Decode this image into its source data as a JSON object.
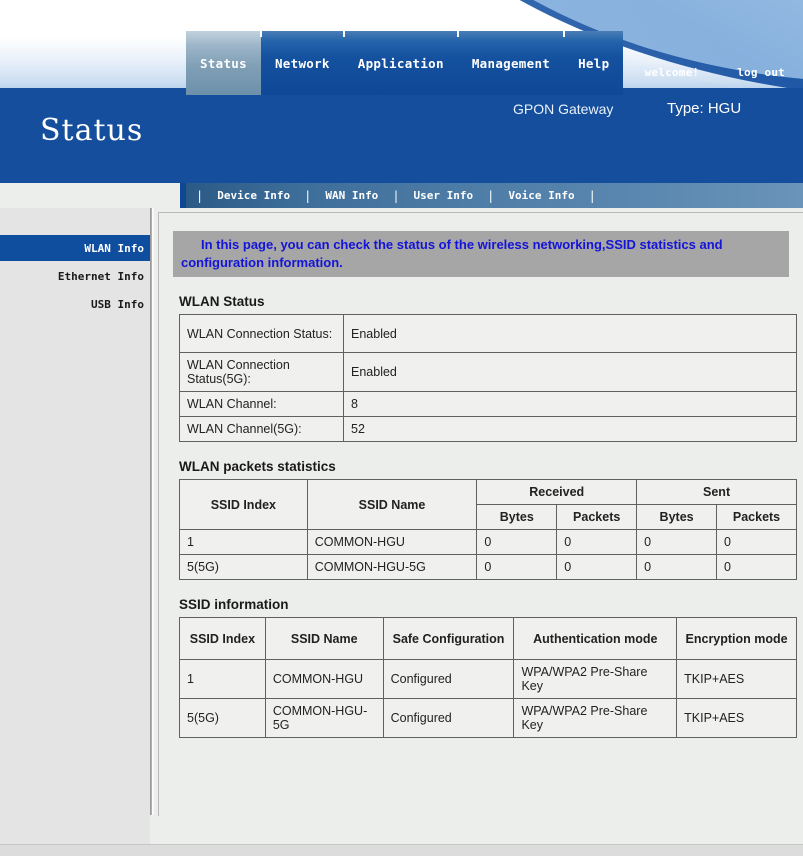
{
  "banner": {
    "welcome_label": "welcome!",
    "logout_label": "log out"
  },
  "header": {
    "page_title": "Status",
    "gateway_label": "GPON Gateway",
    "type_label": "Type: HGU"
  },
  "nav": {
    "tabs": [
      {
        "label": "Status",
        "active": true
      },
      {
        "label": "Network",
        "active": false
      },
      {
        "label": "Application",
        "active": false
      },
      {
        "label": "Management",
        "active": false
      },
      {
        "label": "Help",
        "active": false
      }
    ],
    "subtabs": [
      {
        "label": "Device Info"
      },
      {
        "label": "WAN Info"
      },
      {
        "label": "User Info"
      },
      {
        "label": "Voice Info"
      }
    ],
    "separator": "|"
  },
  "sidebar": {
    "items": [
      {
        "label": "WLAN Info",
        "active": true
      },
      {
        "label": "Ethernet Info",
        "active": false
      },
      {
        "label": "USB Info",
        "active": false
      }
    ]
  },
  "main": {
    "notice": "In this page, you can check the status of the wireless networking,SSID statistics and configuration information.",
    "wlan_status": {
      "title": "WLAN Status",
      "rows": [
        {
          "label": "WLAN Connection Status:",
          "value": "Enabled"
        },
        {
          "label": "WLAN Connection Status(5G):",
          "value": "Enabled"
        },
        {
          "label": "WLAN Channel:",
          "value": "8"
        },
        {
          "label": "WLAN Channel(5G):",
          "value": "52"
        }
      ]
    },
    "packets_statistics": {
      "title": "WLAN packets statistics",
      "headers": {
        "ssid_index": "SSID Index",
        "ssid_name": "SSID Name",
        "received": "Received",
        "sent": "Sent",
        "recv_bytes": "Bytes",
        "recv_packets": "Packets",
        "sent_bytes": "Bytes",
        "sent_packets": "Packets"
      },
      "rows": [
        {
          "index": "1",
          "name": "COMMON-HGU",
          "recv_bytes": "0",
          "recv_packets": "0",
          "sent_bytes": "0",
          "sent_packets": "0"
        },
        {
          "index": "5(5G)",
          "name": "COMMON-HGU-5G",
          "recv_bytes": "0",
          "recv_packets": "0",
          "sent_bytes": "0",
          "sent_packets": "0"
        }
      ]
    },
    "ssid_information": {
      "title": "SSID information",
      "headers": {
        "ssid_index": "SSID Index",
        "ssid_name": "SSID Name",
        "safe_configuration": "Safe Configuration",
        "authentication_mode": "Authentication mode",
        "encryption_mode": "Encryption mode"
      },
      "rows": [
        {
          "index": "1",
          "name": "COMMON-HGU",
          "safe": "Configured",
          "auth": "WPA/WPA2 Pre-Share Key",
          "encryption": "TKIP+AES"
        },
        {
          "index": "5(5G)",
          "name": "COMMON-HGU-5G",
          "safe": "Configured",
          "auth": "WPA/WPA2 Pre-Share Key",
          "encryption": "TKIP+AES"
        }
      ]
    }
  },
  "colors": {
    "nav_blue": "#144e9c",
    "active_sidebar": "#0f4d9e",
    "notice_bg": "#a6a6a6",
    "notice_text": "#1414d8",
    "content_bg": "#eceeeb"
  }
}
